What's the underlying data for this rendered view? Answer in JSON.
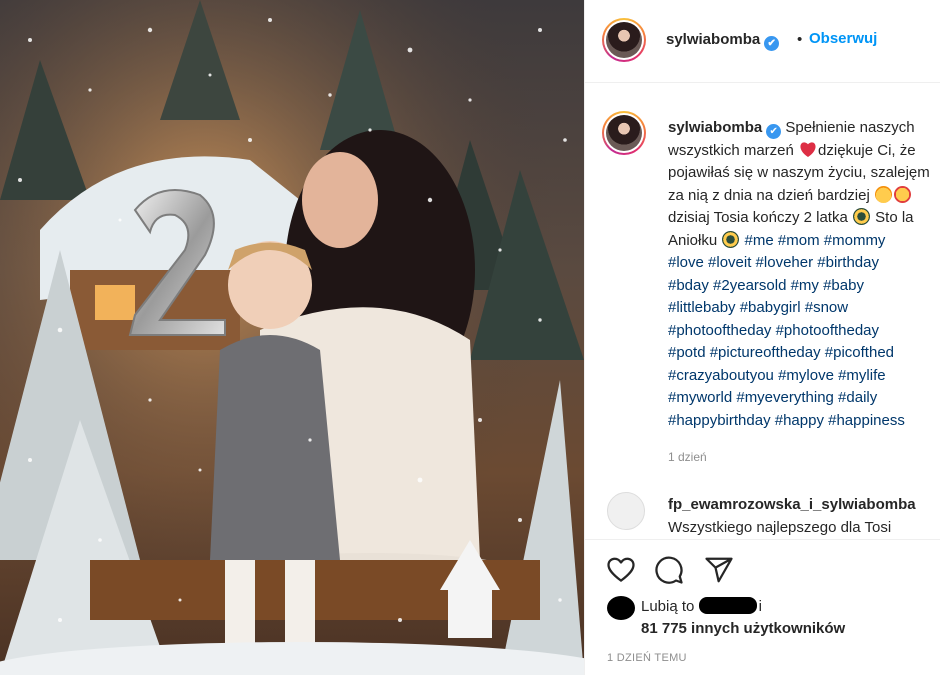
{
  "header": {
    "username": "sylwiabomba",
    "verified_icon": "✔",
    "separator": "•",
    "follow_label": "Obserwuj"
  },
  "caption": {
    "username": "sylwiabomba",
    "lines": [
      "Spełnienie naszych",
      "wszystkich marzeń",
      "dziękuje Ci, że",
      "pojawiłaś się w naszym życiu, szalejęm",
      "za nią z dnia na dzień bardziej",
      "dzisiaj Tosia kończy 2 latka",
      "Sto la",
      "Aniołku"
    ],
    "hashtag_lines": [
      "#me #mom #mommy",
      "#love #loveit #loveher #birthday",
      "#bday #2yearsold #my #baby",
      "#littlebaby #babygirl #snow",
      "#photooftheday #photooftheday",
      "#potd #pictureoftheday #picofthed",
      "#crazyaboutyou #mylove #mylife",
      "#myworld #myeverything #daily",
      "#happybirthday #happy #happiness"
    ],
    "tags_first_line": [
      "#me",
      "#mom",
      "#mommy"
    ],
    "time": "1 dzień"
  },
  "comment": {
    "username": "fp_ewamrozowska_i_sylwiabomba",
    "text": "Wszystkiego najlepszego dla Tosi"
  },
  "actions": {
    "like_icon": "heart-icon",
    "comment_icon": "comment-icon",
    "share_icon": "share-icon"
  },
  "likes": {
    "prefix": "Lubią to",
    "suffix": "i",
    "count_text": "81 775 innych użytkowników"
  },
  "posted": "1 DZIEŃ TEMU",
  "colors": {
    "follow": "#0095f6",
    "hashtag": "#00376b",
    "verified": "#3897f0",
    "muted": "#8e8e8e"
  }
}
